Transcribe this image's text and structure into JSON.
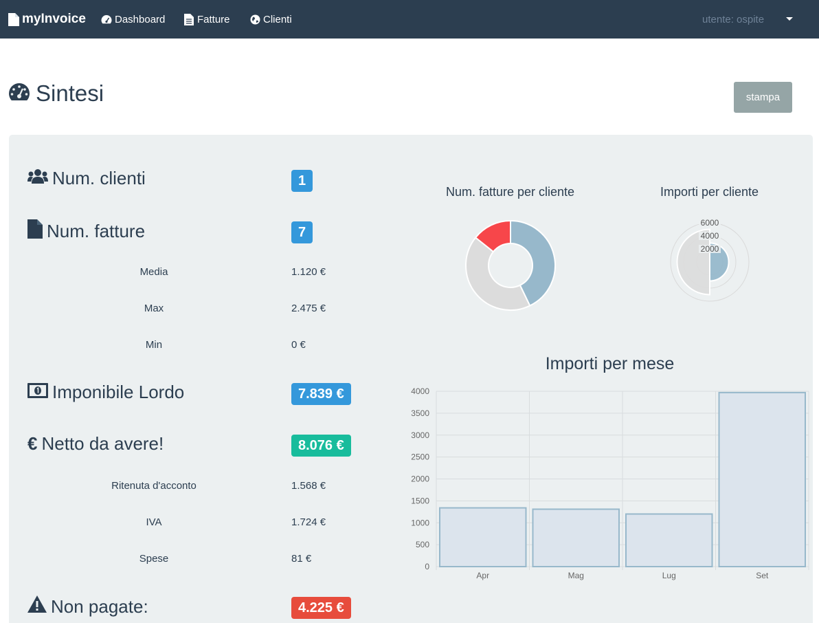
{
  "navbar": {
    "brand": "myInvoice",
    "links": [
      "Dashboard",
      "Fatture",
      "Clienti"
    ],
    "user": "utente: ospite"
  },
  "header": {
    "title": "Sintesi",
    "print_label": "stampa"
  },
  "stats": {
    "clients_label": "Num. clienti",
    "clients_value": "1",
    "invoices_label": "Num. fatture",
    "invoices_value": "7",
    "media_label": "Media",
    "media_value": "1.120 €",
    "max_label": "Max",
    "max_value": "2.475 €",
    "min_label": "Min",
    "min_value": "0 €",
    "gross_label": "Imponibile Lordo",
    "gross_value": "7.839 €",
    "net_label": "Netto da avere!",
    "net_value": "8.076 €",
    "withholding_label": "Ritenuta d'acconto",
    "withholding_value": "1.568 €",
    "vat_label": "IVA",
    "vat_value": "1.724 €",
    "expenses_label": "Spese",
    "expenses_value": "81 €",
    "unpaid_label": "Non pagate:",
    "unpaid_value": "4.225 €"
  },
  "colors": {
    "navbar": "#2c3e50",
    "blue": "#3498db",
    "green": "#18bc9c",
    "red": "#e74c3c",
    "print_button": "#95a5a6",
    "panel": "#ecf0f1"
  },
  "icons": {
    "brand": "file-icon",
    "dashboard": "tachometer-icon",
    "invoices": "file-text-icon",
    "clients": "globe-icon",
    "title": "tachometer-icon",
    "num_clients": "users-icon",
    "num_invoices": "file-icon",
    "gross": "money-icon",
    "net": "euro-icon",
    "unpaid": "warning-icon"
  },
  "chart_data": [
    {
      "type": "pie",
      "title": "Num. fatture per cliente",
      "values": [
        3,
        3,
        1
      ],
      "colors": [
        "#97b8cb",
        "#dcdcdc",
        "#f7464a"
      ]
    },
    {
      "type": "polar",
      "title": "Importi per cliente",
      "values": [
        2900,
        5000
      ],
      "colors": [
        "#97b8cb",
        "#dcdcdc"
      ],
      "scale_ticks": [
        "2000",
        "4000",
        "6000"
      ],
      "max": 6000
    },
    {
      "type": "bar",
      "title": "Importi per mese",
      "categories": [
        "Apr",
        "Mag",
        "Lug",
        "Set"
      ],
      "values": [
        1340,
        1310,
        1200,
        3970
      ],
      "ylim": [
        0,
        4000
      ],
      "yticks": [
        "0",
        "500",
        "1000",
        "1500",
        "2000",
        "2500",
        "3000",
        "3500",
        "4000"
      ],
      "bar_fill": "#dce4ed",
      "bar_stroke": "#97b8cb",
      "grid": true
    }
  ]
}
